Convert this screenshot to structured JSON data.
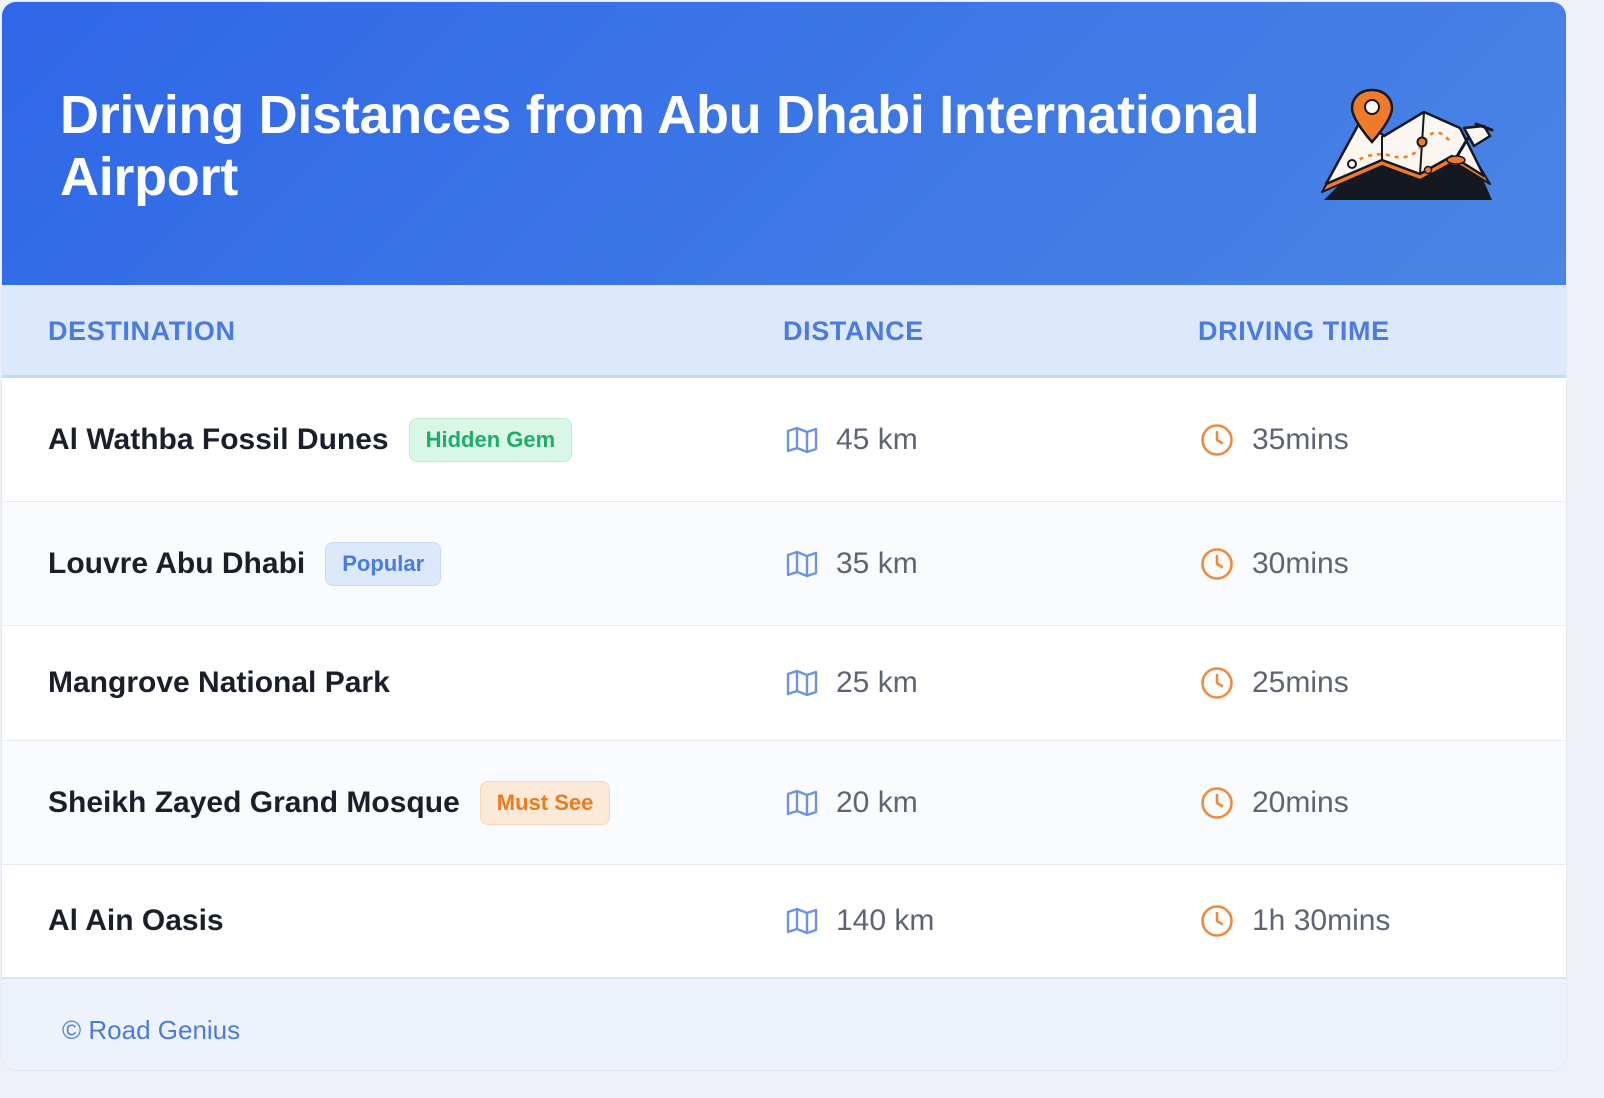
{
  "header": {
    "title": "Driving Distances from Abu Dhabi International Airport",
    "illustration": "map-with-pins-icon"
  },
  "table": {
    "columns": [
      "DESTINATION",
      "DISTANCE",
      "DRIVING TIME"
    ],
    "distance_icon": "map-icon",
    "time_icon": "clock-icon",
    "rows": [
      {
        "destination": "Al Wathba Fossil Dunes",
        "badge": "Hidden Gem",
        "distance": "45 km",
        "time": "35mins"
      },
      {
        "destination": "Louvre Abu Dhabi",
        "badge": "Popular",
        "distance": "35 km",
        "time": "30mins"
      },
      {
        "destination": "Mangrove National Park",
        "badge": "",
        "distance": "25 km",
        "time": "25mins"
      },
      {
        "destination": "Sheikh Zayed Grand Mosque",
        "badge": "Must See",
        "distance": "20 km",
        "time": "20mins"
      },
      {
        "destination": "Al Ain Oasis",
        "badge": "",
        "distance": "140 km",
        "time": "1h 30mins"
      }
    ]
  },
  "footer": {
    "credit": "© Road Genius"
  },
  "colors": {
    "header_blue": "#2f67e8",
    "accent_blue": "#4b7be0",
    "badge_green": "#1fae68",
    "badge_orange": "#ee7a1c",
    "clock_orange": "#ef8a3d"
  }
}
